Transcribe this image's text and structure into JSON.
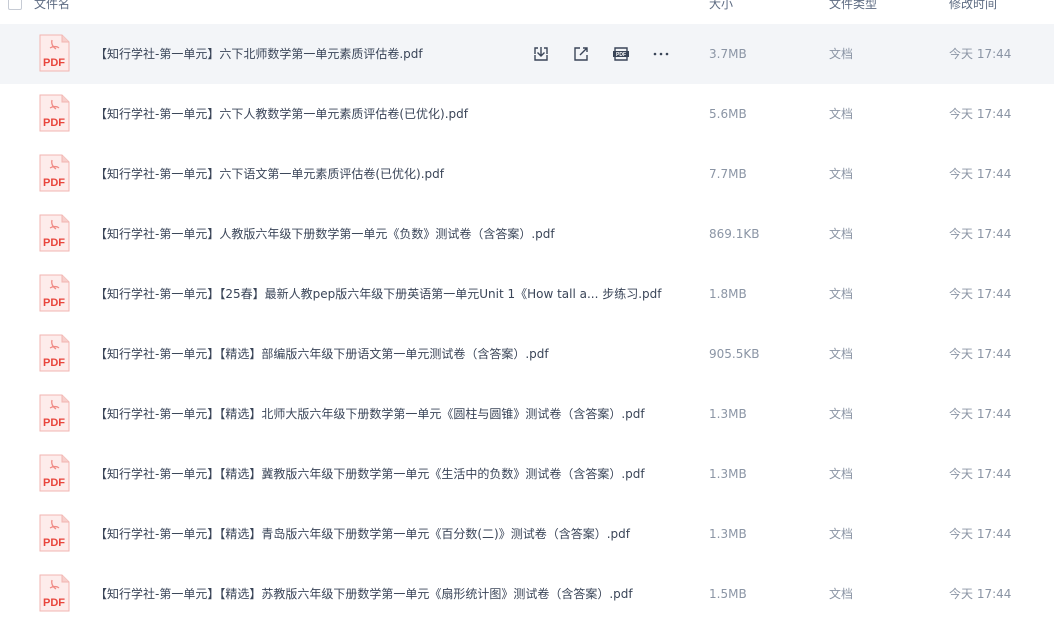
{
  "header": {
    "name": "文件名",
    "size": "大小",
    "type": "文件类型",
    "modified": "修改时间"
  },
  "icons": {
    "pdf_label": "PDF",
    "pdf_text_color": "#e8453c",
    "pdf_bg_color": "#fdeceb"
  },
  "actions": [
    "download-icon",
    "share-icon",
    "pdf-tool-icon",
    "more-icon"
  ],
  "files": [
    {
      "name": "【知行学社-第一单元】六下北师数学第一单元素质评估卷.pdf",
      "size": "3.7MB",
      "type": "文档",
      "modified": "今天 17:44",
      "hovered": true
    },
    {
      "name": "【知行学社-第一单元】六下人教数学第一单元素质评估卷(已优化).pdf",
      "size": "5.6MB",
      "type": "文档",
      "modified": "今天 17:44"
    },
    {
      "name": "【知行学社-第一单元】六下语文第一单元素质评估卷(已优化).pdf",
      "size": "7.7MB",
      "type": "文档",
      "modified": "今天 17:44"
    },
    {
      "name": "【知行学社-第一单元】人教版六年级下册数学第一单元《负数》测试卷（含答案）.pdf",
      "size": "869.1KB",
      "type": "文档",
      "modified": "今天 17:44"
    },
    {
      "name": "【知行学社-第一单元】【25春】最新人教pep版六年级下册英语第一单元Unit 1《How tall a... 步练习.pdf",
      "size": "1.8MB",
      "type": "文档",
      "modified": "今天 17:44"
    },
    {
      "name": "【知行学社-第一单元】【精选】部编版六年级下册语文第一单元测试卷（含答案）.pdf",
      "size": "905.5KB",
      "type": "文档",
      "modified": "今天 17:44"
    },
    {
      "name": "【知行学社-第一单元】【精选】北师大版六年级下册数学第一单元《圆柱与圆锥》测试卷（含答案）.pdf",
      "size": "1.3MB",
      "type": "文档",
      "modified": "今天 17:44"
    },
    {
      "name": "【知行学社-第一单元】【精选】冀教版六年级下册数学第一单元《生活中的负数》测试卷（含答案）.pdf",
      "size": "1.3MB",
      "type": "文档",
      "modified": "今天 17:44"
    },
    {
      "name": "【知行学社-第一单元】【精选】青岛版六年级下册数学第一单元《百分数(二)》测试卷（含答案）.pdf",
      "size": "1.3MB",
      "type": "文档",
      "modified": "今天 17:44"
    },
    {
      "name": "【知行学社-第一单元】【精选】苏教版六年级下册数学第一单元《扇形统计图》测试卷（含答案）.pdf",
      "size": "1.5MB",
      "type": "文档",
      "modified": "今天 17:44"
    }
  ]
}
